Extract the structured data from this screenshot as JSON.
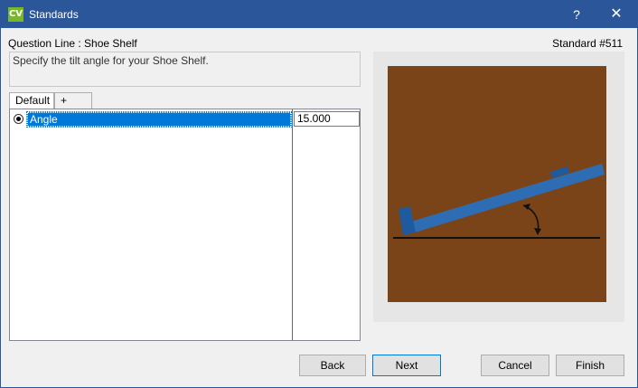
{
  "window": {
    "title": "Standards",
    "app_icon_text": "CV",
    "help_label": "?",
    "close_label": "✕"
  },
  "header": {
    "question_line": "Question Line : Shoe Shelf",
    "standard_number": "Standard #511",
    "description": "Specify the tilt angle for your Shoe Shelf."
  },
  "tabs": [
    {
      "label": "Default",
      "selected": true
    },
    {
      "label": "+",
      "selected": false
    }
  ],
  "grid": {
    "rows": [
      {
        "label": "Angle",
        "value": "15.000",
        "selected": true
      }
    ]
  },
  "preview": {
    "background_color": "#7a4418",
    "shelf_color": "#2e6db4",
    "frame_color": "#e6e6e6"
  },
  "buttons": {
    "back": "Back",
    "next": "Next",
    "cancel": "Cancel",
    "finish": "Finish"
  },
  "colors": {
    "titlebar": "#2b579a",
    "selection": "#0078d7",
    "app_icon": "#78b62c"
  }
}
